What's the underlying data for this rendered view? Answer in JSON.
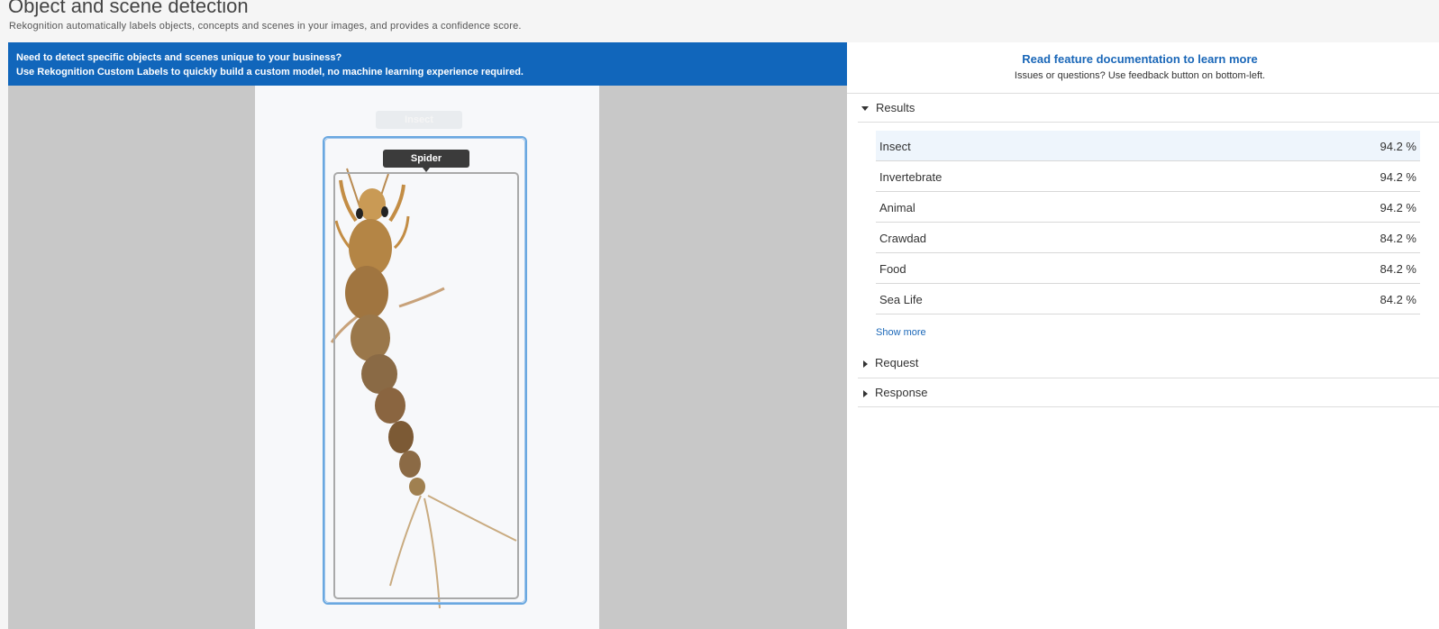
{
  "header": {
    "title": "Object and scene detection",
    "subtitle": "Rekognition automatically labels objects, concepts and scenes in your images, and provides a confidence score."
  },
  "banner": {
    "line1": "Need to detect specific objects and scenes unique to your business?",
    "line2_prefix": "Use ",
    "line2_link": "Rekognition Custom Labels",
    "line2_suffix": " to quickly build a custom model, no machine learning experience required.",
    "color": "#1166bb"
  },
  "image": {
    "labels": [
      "Insect",
      "Spider"
    ]
  },
  "sidebar": {
    "doc_link": "Read feature documentation to learn more",
    "doc_note": "Issues or questions? Use feedback button on bottom-left.",
    "sections": {
      "results": "Results",
      "request": "Request",
      "response": "Response"
    },
    "results": [
      {
        "label": "Insect",
        "score": "94.2 %"
      },
      {
        "label": "Invertebrate",
        "score": "94.2 %"
      },
      {
        "label": "Animal",
        "score": "94.2 %"
      },
      {
        "label": "Crawdad",
        "score": "84.2 %"
      },
      {
        "label": "Food",
        "score": "84.2 %"
      },
      {
        "label": "Sea Life",
        "score": "84.2 %"
      }
    ],
    "show_more": "Show more"
  },
  "colors": {
    "link": "#1a67b8",
    "accent_box": "#6aa8e0",
    "selected_row": "#eef5fc"
  }
}
